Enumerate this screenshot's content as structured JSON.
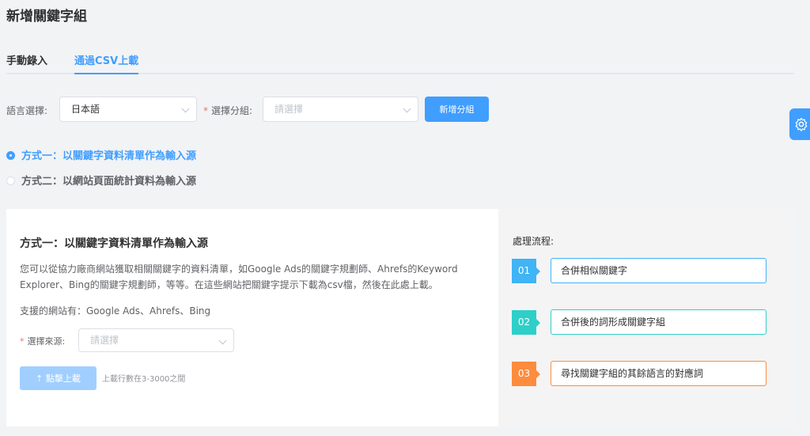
{
  "page": {
    "title": "新增關鍵字組"
  },
  "tabs": [
    {
      "label": "手動錄入",
      "active": false
    },
    {
      "label": "通過CSV上載",
      "active": true
    }
  ],
  "form": {
    "language_label": "語言選擇:",
    "language_value": "日本語",
    "group_label": "選擇分組:",
    "group_placeholder": "請選擇",
    "add_group_button": "新增分組"
  },
  "methods": {
    "option1": "方式一：以關鍵字資料清單作為輸入源",
    "option2": "方式二：以網站頁面統計資料為輸入源",
    "selected": "option1"
  },
  "panel": {
    "title": "方式一：以關鍵字資料清單作為輸入源",
    "description": "您可以從協力廠商網站獲取相關關鍵字的資料清單，如Google Ads的關鍵字規劃師、Ahrefs的Keyword Explorer、Bing的關鍵字規劃師，等等。在這些網站把關鍵字提示下載為csv檔，然後在此處上載。",
    "supported_sites": "支援的網站有：Google Ads、Ahrefs、Bing",
    "source_label": "選擇來源:",
    "source_placeholder": "請選擇",
    "upload_button": "點擊上載",
    "upload_hint": "上載行數在3-3000之間"
  },
  "process": {
    "title": "處理流程:",
    "steps": [
      {
        "num": "01",
        "label": "合併相似關鍵字",
        "color": "#40b4f5"
      },
      {
        "num": "02",
        "label": "合併後的詞形成關鍵字組",
        "color": "#2ecfc9"
      },
      {
        "num": "03",
        "label": "尋找關鍵字組的其餘語言的對應詞",
        "color": "#fe8c3e"
      }
    ]
  },
  "colors": {
    "primary": "#409eff",
    "required": "#f56c6c"
  },
  "icons": {
    "settings": "gear-icon",
    "upload": "upload-arrow-icon"
  }
}
